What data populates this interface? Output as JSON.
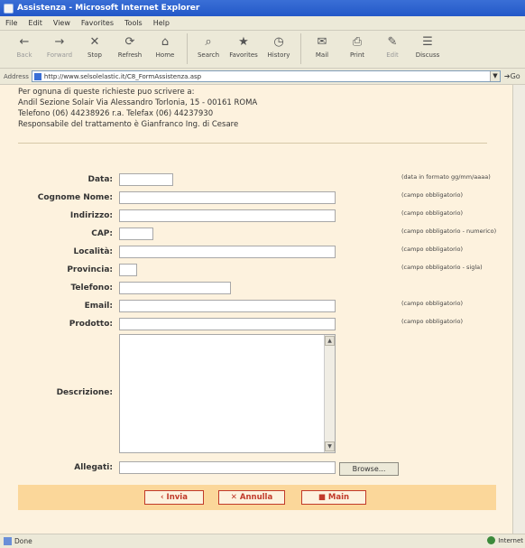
{
  "window": {
    "title": "Assistenza - Microsoft Internet Explorer"
  },
  "menu": [
    "File",
    "Edit",
    "View",
    "Favorites",
    "Tools",
    "Help"
  ],
  "toolbar": [
    {
      "label": "Back",
      "icon": "back-arrow-icon",
      "glyph": "←",
      "disabled": true
    },
    {
      "label": "Forward",
      "icon": "forward-arrow-icon",
      "glyph": "→",
      "disabled": true
    },
    {
      "label": "Stop",
      "icon": "stop-icon",
      "glyph": "✕",
      "disabled": false
    },
    {
      "label": "Refresh",
      "icon": "refresh-icon",
      "glyph": "⟳",
      "disabled": false
    },
    {
      "label": "Home",
      "icon": "home-icon",
      "glyph": "⌂",
      "disabled": false
    },
    {
      "label": "Search",
      "icon": "search-icon",
      "glyph": "⌕",
      "disabled": false
    },
    {
      "label": "Favorites",
      "icon": "favorites-icon",
      "glyph": "★",
      "disabled": false
    },
    {
      "label": "History",
      "icon": "history-icon",
      "glyph": "◷",
      "disabled": false
    },
    {
      "label": "Mail",
      "icon": "mail-icon",
      "glyph": "✉",
      "disabled": false
    },
    {
      "label": "Print",
      "icon": "print-icon",
      "glyph": "⎙",
      "disabled": false
    },
    {
      "label": "Edit",
      "icon": "edit-icon",
      "glyph": "✎",
      "disabled": true
    },
    {
      "label": "Discuss",
      "icon": "discuss-icon",
      "glyph": "☰",
      "disabled": false
    }
  ],
  "address": {
    "label": "Address",
    "url": "http://www.selsolelastic.it/C8_FormAssistenza.asp",
    "go": "Go"
  },
  "header": {
    "lines": [
      "Per ognuna di queste richieste puo scrivere a:",
      "Andil Sezione Solair Via Alessandro Torlonia, 15 - 00161 ROMA",
      "Telefono (06) 44238926 r.a. Telefax (06) 44237930",
      "Responsabile del trattamento è Gianfranco Ing. di Cesare"
    ]
  },
  "form": {
    "fields": [
      {
        "label": "Data:",
        "note": "(data in formato gg/mm/aaaa)"
      },
      {
        "label": "Cognome Nome:",
        "note": "(campo obbligatorio)"
      },
      {
        "label": "Indirizzo:",
        "note": "(campo obbligatorio)"
      },
      {
        "label": "CAP:",
        "note": "(campo obbligatorio - numerico)"
      },
      {
        "label": "Località:",
        "note": "(campo obbligatorio)"
      },
      {
        "label": "Provincia:",
        "note": "(campo obbligatorio - sigla)"
      },
      {
        "label": "Telefono:",
        "note": ""
      },
      {
        "label": "Email:",
        "note": "(campo obbligatorio)"
      },
      {
        "label": "Prodotto:",
        "note": "(campo obbligatorio)"
      }
    ],
    "description_label": "Descrizione:",
    "attachments_label": "Allegati:",
    "browse_label": "Browse..."
  },
  "actions": [
    {
      "label": "Invia",
      "glyph": "‹"
    },
    {
      "label": "Annulla",
      "glyph": "✕"
    },
    {
      "label": "Main",
      "glyph": "■"
    }
  ],
  "status": {
    "text": "Done",
    "zone": "Internet"
  }
}
